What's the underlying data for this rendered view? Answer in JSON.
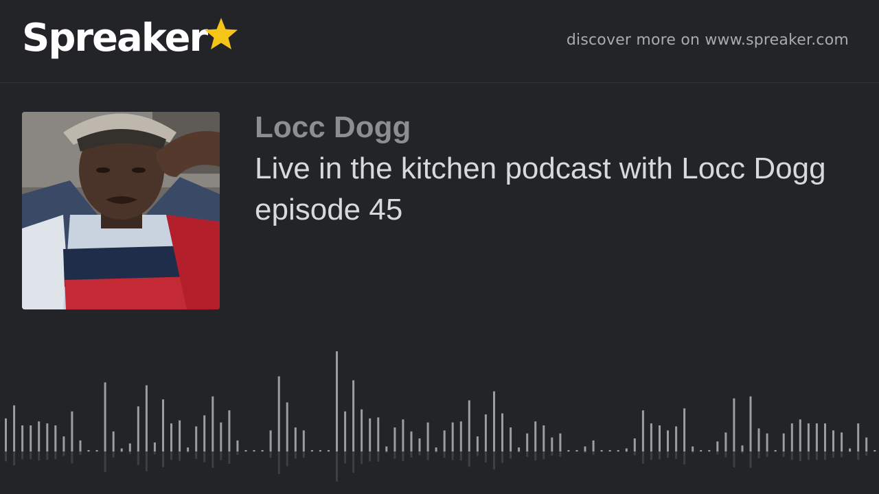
{
  "brand": {
    "name": "Spreaker",
    "star_color": "#f5c518",
    "icon": "star-icon"
  },
  "header": {
    "discover_text": "discover more on www.spreaker.com"
  },
  "episode": {
    "show_name": "Locc Dogg",
    "title": "Live in the kitchen podcast with Locc Dogg episode 45",
    "cover_description": "podcast-cover-art"
  },
  "waveform": {
    "bar_color": "#9c9ea2",
    "levels": [
      0.33,
      0.46,
      0.26,
      0.26,
      0.3,
      0.28,
      0.26,
      0.15,
      0.4,
      0.11,
      0.01,
      0.01,
      0.69,
      0.2,
      0.03,
      0.08,
      0.45,
      0.66,
      0.09,
      0.52,
      0.28,
      0.31,
      0.04,
      0.25,
      0.36,
      0.55,
      0.29,
      0.41,
      0.11,
      0.01,
      0.01,
      0.01,
      0.21,
      0.75,
      0.49,
      0.24,
      0.21,
      0.01,
      0.01,
      0.01,
      1.0,
      0.4,
      0.71,
      0.42,
      0.33,
      0.34,
      0.05,
      0.24,
      0.32,
      0.2,
      0.13,
      0.29,
      0.04,
      0.21,
      0.29,
      0.3,
      0.51,
      0.15,
      0.37,
      0.6,
      0.38,
      0.24,
      0.04,
      0.18,
      0.3,
      0.26,
      0.14,
      0.18,
      0.01,
      0.01,
      0.05,
      0.11,
      0.01,
      0.01,
      0.01,
      0.03,
      0.13,
      0.41,
      0.28,
      0.26,
      0.21,
      0.25,
      0.43,
      0.05,
      0.01,
      0.01,
      0.1,
      0.19,
      0.53,
      0.06,
      0.55,
      0.23,
      0.18,
      0.01,
      0.18,
      0.28,
      0.32,
      0.28,
      0.28,
      0.28,
      0.21,
      0.19,
      0.03,
      0.28,
      0.14,
      0.01
    ]
  }
}
